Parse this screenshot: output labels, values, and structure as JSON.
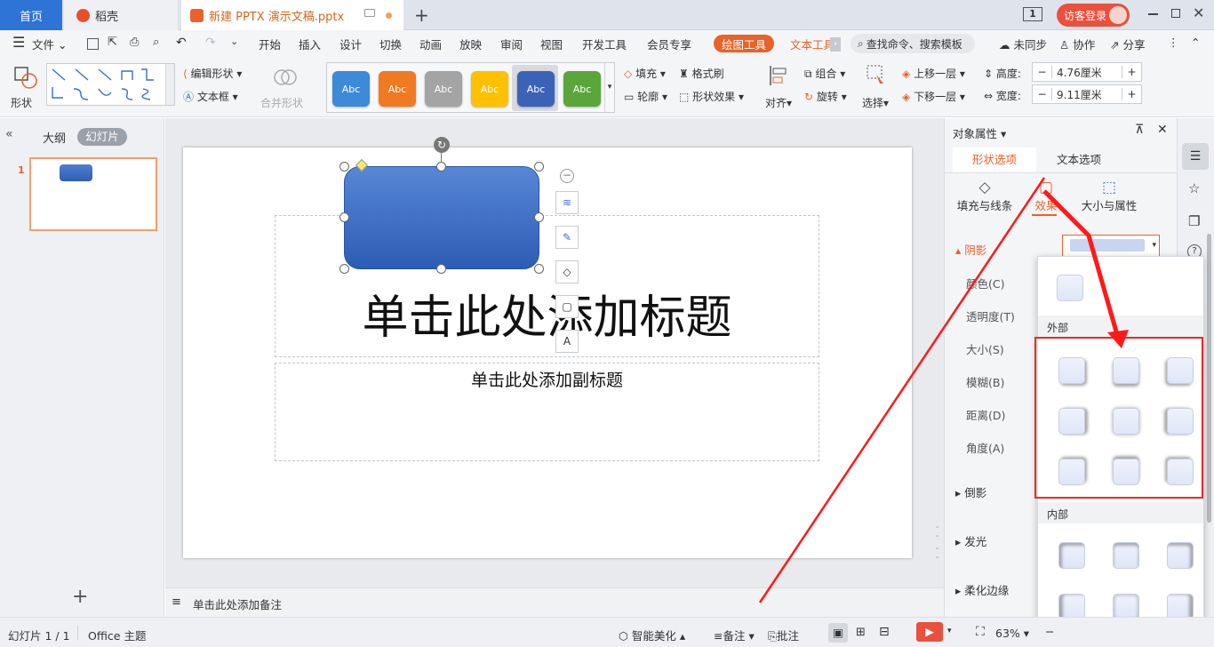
{
  "tabs": {
    "home": "首页",
    "daoke": "稻壳",
    "doc": "新建 PPTX 演示文稿.pptx"
  },
  "titlebar": {
    "page_indicator": "1",
    "login": "访客登录"
  },
  "menu": {
    "file": "文件",
    "items": [
      "开始",
      "插入",
      "设计",
      "切换",
      "动画",
      "放映",
      "审阅",
      "视图",
      "开发工具",
      "会员专享"
    ],
    "active": "绘图工具",
    "text_tools": "文本工具",
    "search": "查找命令、搜索模板",
    "sync": "未同步",
    "collab": "协作",
    "share": "分享"
  },
  "ribbon": {
    "shape": "形状",
    "edit_shape": "编辑形状",
    "textbox": "文本框",
    "merge_shape": "合并形状",
    "style_label": "Abc",
    "fill": "填充",
    "outline": "轮廓",
    "format_brush": "格式刷",
    "shape_effect": "形状效果",
    "align": "对齐",
    "group": "组合",
    "rotate": "旋转",
    "select": "选择",
    "bring_forward": "上移一层",
    "send_backward": "下移一层",
    "height_label": "高度:",
    "height_value": "4.76厘米",
    "width_label": "宽度:",
    "width_value": "9.11厘米",
    "style_colors": [
      "#3d8ad8",
      "#f07a22",
      "#a4a4a4",
      "#ffc000",
      "#3a63b8",
      "#5aa63b"
    ]
  },
  "left_panel": {
    "outline_tab": "大纲",
    "slides_tab": "幻灯片",
    "slide_number": "1"
  },
  "slide": {
    "title": "单击此处添加标题",
    "subtitle": "单击此处添加副标题"
  },
  "notes": {
    "placeholder": "单击此处添加备注"
  },
  "right_panel": {
    "title": "对象属性",
    "tab_shape": "形状选项",
    "tab_text": "文本选项",
    "sub_fill": "填充与线条",
    "sub_effect": "效果",
    "sub_size": "大小与属性",
    "shadow": "阴影",
    "color": "颜色(C)",
    "transparency": "透明度(T)",
    "size": "大小(S)",
    "blur": "模糊(B)",
    "distance": "距离(D)",
    "angle": "角度(A)",
    "reflection": "倒影",
    "glow": "发光",
    "soft_edge": "柔化边缘"
  },
  "dropdown": {
    "outer": "外部",
    "inner": "内部"
  },
  "status": {
    "slide_count": "幻灯片 1 / 1",
    "theme": "Office 主题",
    "beautify": "智能美化",
    "notes": "备注",
    "comment": "批注",
    "zoom": "63%"
  }
}
